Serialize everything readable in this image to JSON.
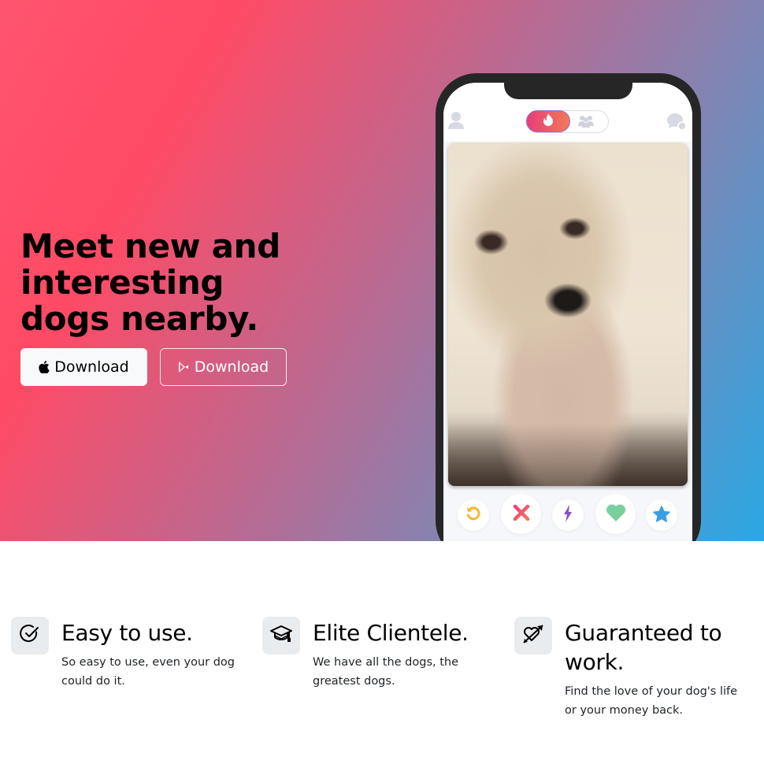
{
  "hero": {
    "title": "Meet new and interesting dogs nearby.",
    "buttons": [
      {
        "label": "Download",
        "icon": "apple-icon",
        "style": "light"
      },
      {
        "label": "Download",
        "icon": "google-play-icon",
        "style": "outline"
      }
    ],
    "gradient_colors": [
      "#ff4a65",
      "#c0678e",
      "#7f86b5",
      "#2aa8e4"
    ]
  },
  "phone": {
    "top_bar": {
      "left_icon": "profile-icon",
      "toggle": {
        "active": "flame-icon",
        "inactive": "group-icon"
      },
      "right_icon": "chat-icon"
    },
    "card": {
      "image": "dog-photo",
      "alt": "Wet terrier dog looking at the camera"
    },
    "actions": [
      {
        "name": "rewind",
        "icon": "rewind-icon",
        "color": "#f5b82e"
      },
      {
        "name": "nope",
        "icon": "close-icon",
        "color": "#f0506e"
      },
      {
        "name": "boost",
        "icon": "lightning-icon",
        "color": "#8a4fc7"
      },
      {
        "name": "like",
        "icon": "heart-icon",
        "color": "#6fcf97"
      },
      {
        "name": "super-like",
        "icon": "star-icon",
        "color": "#3a9ee4"
      }
    ]
  },
  "features": [
    {
      "icon": "check-circle-icon",
      "title": "Easy to use.",
      "description": "So easy to use, even your dog could do it."
    },
    {
      "icon": "graduation-cap-icon",
      "title": "Elite Clientele.",
      "description": "We have all the dogs, the greatest dogs."
    },
    {
      "icon": "heart-arrow-icon",
      "title": "Guaranteed to work.",
      "description": "Find the love of your dog's life or your money back."
    }
  ]
}
